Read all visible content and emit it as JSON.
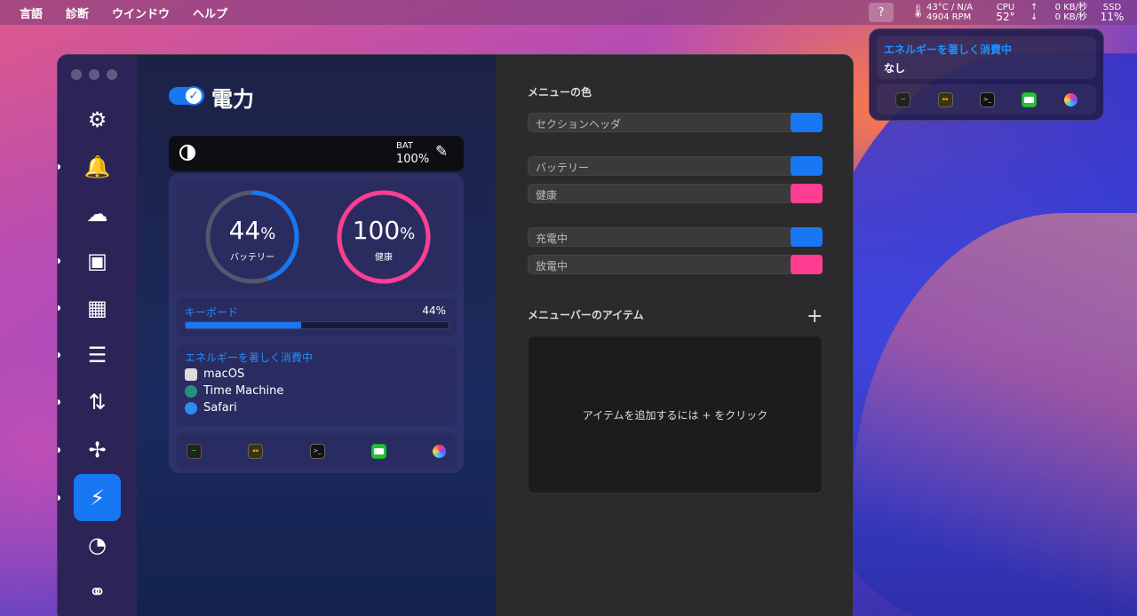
{
  "menubar": {
    "items": [
      "言語",
      "診断",
      "ウインドウ",
      "ヘルプ"
    ],
    "help": "?",
    "temp": "43°C / N/A",
    "rpm": "4904 RPM",
    "cpu_label": "CPU",
    "cpu_value": "52°",
    "net_up": "0 KB/秒",
    "net_down": "0 KB/秒",
    "ssd_label": "SSD",
    "ssd_value": "11%"
  },
  "popover": {
    "title": "エネルギーを著しく消費中",
    "value": "なし"
  },
  "sidebar": {
    "items": [
      {
        "name": "gear-icon",
        "glyph": "⚙"
      },
      {
        "name": "bell-icon",
        "glyph": "🔔"
      },
      {
        "name": "cloud-icon",
        "glyph": "☁"
      },
      {
        "name": "cpu-icon",
        "glyph": "▣"
      },
      {
        "name": "memory-icon",
        "glyph": "▦"
      },
      {
        "name": "storage-icon",
        "glyph": "☰"
      },
      {
        "name": "network-icon",
        "glyph": "⇅"
      },
      {
        "name": "fan-icon",
        "glyph": "✢"
      },
      {
        "name": "power-icon",
        "glyph": "⚡"
      },
      {
        "name": "clock-icon",
        "glyph": "◔"
      },
      {
        "name": "rings-icon",
        "glyph": "⚭"
      }
    ]
  },
  "power": {
    "title": "電力",
    "bat_label": "BAT",
    "bat_value": "100%",
    "battery_gauge": {
      "value": "44",
      "unit": "%",
      "caption": "バッテリー",
      "fraction": 0.44,
      "color": "#1877f2"
    },
    "health_gauge": {
      "value": "100",
      "unit": "%",
      "caption": "健康",
      "fraction": 1.0,
      "color": "#ff3e92"
    },
    "keyboard": {
      "label": "キーボード",
      "value": "44%",
      "fraction": 0.44
    },
    "energy": {
      "title": "エネルギーを著しく消費中",
      "processes": [
        "macOS",
        "Time Machine",
        "Safari"
      ]
    }
  },
  "settings": {
    "menu_color_heading": "メニューの色",
    "rows": [
      {
        "label": "セクションヘッダ",
        "color": "#1877f2"
      },
      {
        "label": "バッテリー",
        "color": "#1877f2"
      },
      {
        "label": "健康",
        "color": "#ff3e92"
      },
      {
        "label": "充電中",
        "color": "#1877f2"
      },
      {
        "label": "放電中",
        "color": "#ff3e92"
      }
    ],
    "menubar_items_heading": "メニューバーのアイテム",
    "plus": "+",
    "empty_message": "アイテムを追加するには + をクリック"
  }
}
